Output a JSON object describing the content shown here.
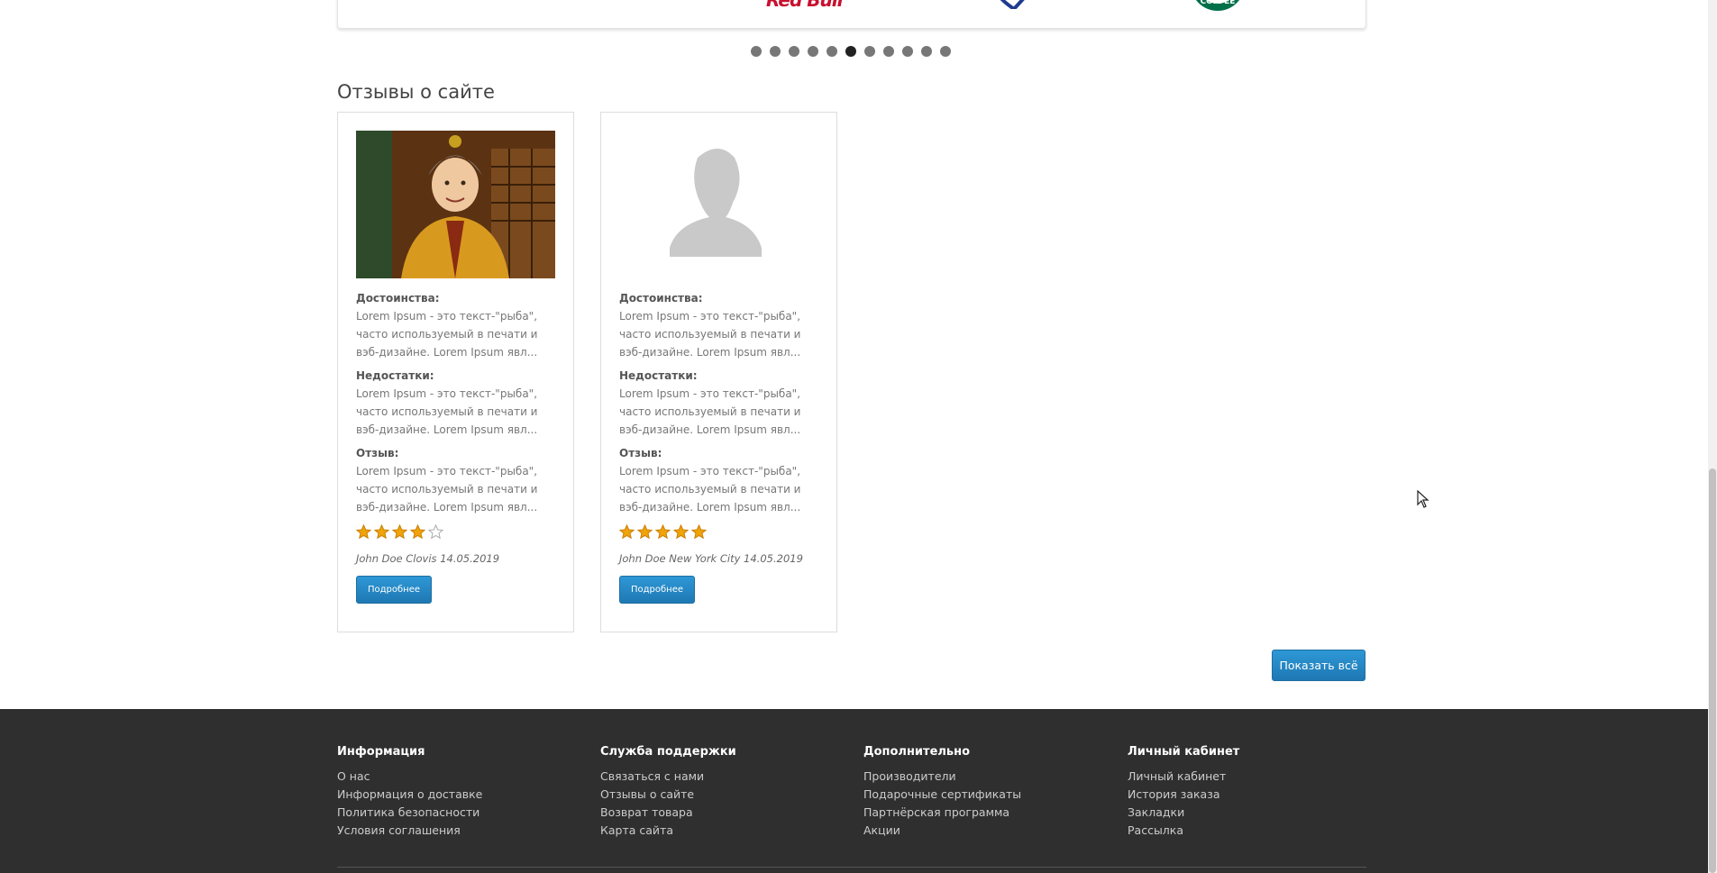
{
  "carousel": {
    "brands": [
      "Red Bull",
      "shield-logo",
      "Starbucks Coffee"
    ],
    "dot_count": 11,
    "active_dot": 5
  },
  "reviews_section": {
    "title": "Отзывы о сайте",
    "show_all_label": "Показать всё",
    "cards": [
      {
        "photo": "avatar-cartoon",
        "pros_label": "Достоинства:",
        "pros_text": "Lorem Ipsum - это текст-\"рыба\", часто используемый в печати и вэб-дизайне. Lorem Ipsum явл...",
        "cons_label": "Недостатки:",
        "cons_text": "Lorem Ipsum - это текст-\"рыба\", часто используемый в печати и вэб-дизайне. Lorem Ipsum явл...",
        "review_label": "Отзыв:",
        "review_text": "Lorem Ipsum - это текст-\"рыба\", часто используемый в печати и вэб-дизайне. Lorem Ipsum явл...",
        "rating": 4,
        "author": "John Doe Clovis 14.05.2019",
        "more_label": "Подробнее"
      },
      {
        "photo": "avatar-placeholder",
        "pros_label": "Достоинства:",
        "pros_text": "Lorem Ipsum - это текст-\"рыба\", часто используемый в печати и вэб-дизайне. Lorem Ipsum явл...",
        "cons_label": "Недостатки:",
        "cons_text": "Lorem Ipsum - это текст-\"рыба\", часто используемый в печати и вэб-дизайне. Lorem Ipsum явл...",
        "review_label": "Отзыв:",
        "review_text": "Lorem Ipsum - это текст-\"рыба\", часто используемый в печати и вэб-дизайне. Lorem Ipsum явл...",
        "rating": 5,
        "author": "John Doe New York City 14.05.2019",
        "more_label": "Подробнее"
      }
    ]
  },
  "footer": {
    "columns": [
      {
        "title": "Информация",
        "links": [
          "О нас",
          "Информация о доставке",
          "Политика безопасности",
          "Условия соглашения"
        ]
      },
      {
        "title": "Служба поддержки",
        "links": [
          "Связаться с нами",
          "Отзывы о сайте",
          "Возврат товара",
          "Карта сайта"
        ]
      },
      {
        "title": "Дополнительно",
        "links": [
          "Производители",
          "Подарочные сертификаты",
          "Партнёрская программа",
          "Акции"
        ]
      },
      {
        "title": "Личный кабинет",
        "links": [
          "Личный кабинет",
          "История заказа",
          "Закладки",
          "Рассылка"
        ]
      }
    ]
  },
  "colors": {
    "accent": "#2a8bc7",
    "footer_bg": "#2f2f2f",
    "star": "#f0a30a"
  }
}
